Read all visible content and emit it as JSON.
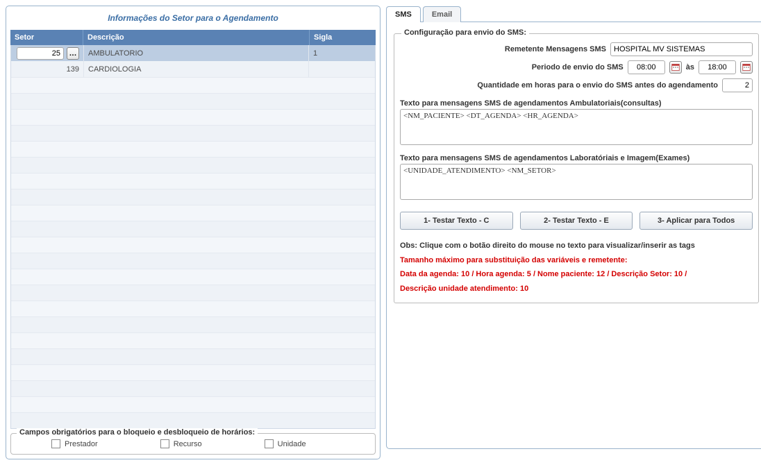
{
  "left": {
    "title": "Informações do Setor para o Agendamento",
    "columns": {
      "setor": "Setor",
      "descricao": "Descrição",
      "sigla": "Sigla"
    },
    "rows": [
      {
        "setor": "25",
        "descricao": "AMBULATORIO",
        "sigla": "1"
      },
      {
        "setor": "139",
        "descricao": "CARDIOLOGIA",
        "sigla": ""
      }
    ],
    "mandatory": {
      "legend": "Campos obrigatórios para o bloqueio e desbloqueio de horários:",
      "prestador": "Prestador",
      "recurso": "Recurso",
      "unidade": "Unidade"
    }
  },
  "tabs": {
    "sms": "SMS",
    "email": "Email"
  },
  "sms": {
    "fieldset_legend": "Configuração para envio do SMS:",
    "remetente_label": "Remetente Mensagens SMS",
    "remetente_value": "HOSPITAL MV SISTEMAS",
    "periodo_label": "Periodo de envio do SMS",
    "periodo_from": "08:00",
    "periodo_to_label": "às",
    "periodo_to": "18:00",
    "qtd_label": "Quantidade em horas para o envio do SMS antes do agendamento",
    "qtd_value": "2",
    "txt1_label": "Texto para mensagens SMS de agendamentos Ambulatoriais(consultas)",
    "txt1_value": "<NM_PACIENTE> <DT_AGENDA> <HR_AGENDA>",
    "txt2_label": "Texto para mensagens SMS de agendamentos Laboratóriais e Imagem(Exames)",
    "txt2_value": "<UNIDADE_ATENDIMENTO> <NM_SETOR>",
    "btn1": "1- Testar Texto - C",
    "btn2": "2- Testar Texto - E",
    "btn3": "3- Aplicar para Todos",
    "obs": "Obs: Clique com o botão direito do mouse no texto para visualizar/inserir as tags",
    "red1": "Tamanho máximo para substituição das variáveis e remetente:",
    "red2": "Data da agenda: 10 / Hora agenda: 5 / Nome paciente: 12 / Descrição Setor: 10 /",
    "red3": "Descrição unidade atendimento: 10"
  }
}
